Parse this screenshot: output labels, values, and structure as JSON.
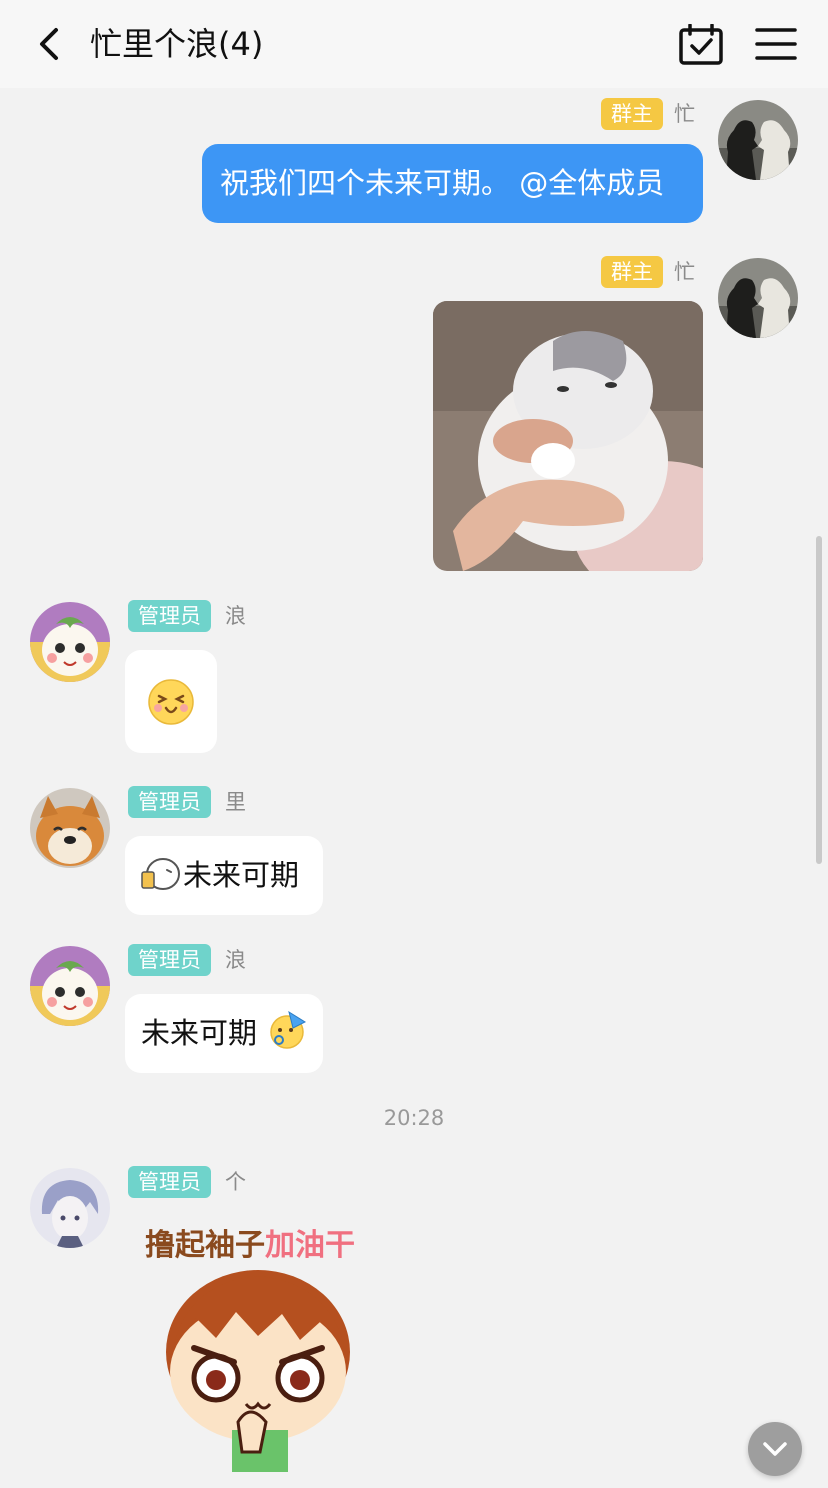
{
  "header": {
    "back_icon": "chevron-left-icon",
    "title": "忙里个浪(4)",
    "calendar_icon": "calendar-check-icon",
    "menu_icon": "hamburger-menu-icon"
  },
  "colors": {
    "header_bg": "#f7f7f7",
    "page_bg": "#f2f2f2",
    "bubble_blue": "#3d96f5",
    "owner_badge": "#f5c843",
    "admin_badge": "#6fd3cb"
  },
  "messages": [
    {
      "side": "right",
      "badge": "群主",
      "sender": "忙",
      "text": "祝我们四个未来可期。 @全体成员",
      "kind": "text"
    },
    {
      "side": "right",
      "badge": "群主",
      "sender": "忙",
      "kind": "image",
      "image_desc": "cat-photo"
    },
    {
      "side": "left",
      "badge": "管理员",
      "sender": "浪",
      "kind": "emoji",
      "emoji": "laughing-face-emoji"
    },
    {
      "side": "left",
      "badge": "管理员",
      "sender": "里",
      "kind": "text",
      "text": "未来可期",
      "prefix_emoji": "cheers-emoji"
    },
    {
      "side": "left",
      "badge": "管理员",
      "sender": "浪",
      "kind": "text",
      "text": "未来可期",
      "suffix_emoji": "party-face-emoji"
    },
    {
      "side": "left",
      "badge": "管理员",
      "sender": "个",
      "kind": "sticker",
      "sticker_text_a": "撸起袖子",
      "sticker_text_b": "加油干"
    }
  ],
  "timestamp": "20:28",
  "scroll_down_icon": "chevron-down-icon"
}
